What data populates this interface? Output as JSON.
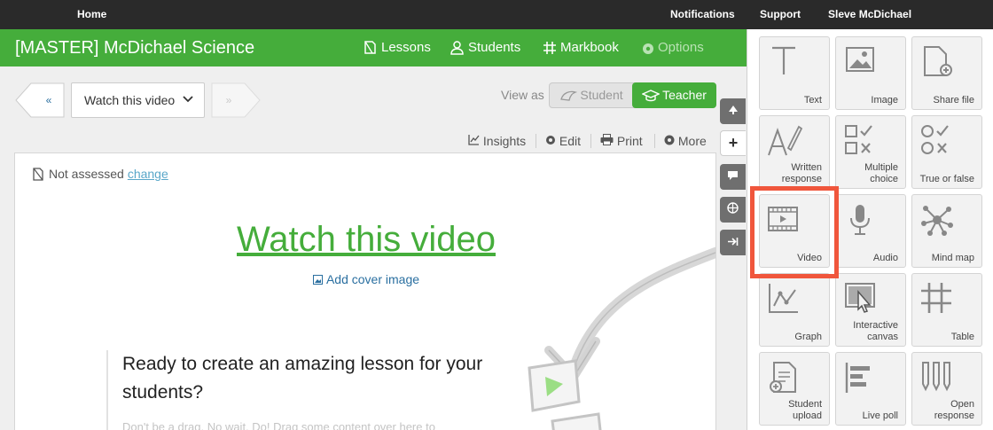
{
  "topbar": {
    "home": "Home",
    "notifications": "Notifications",
    "support": "Support",
    "user": "Sleve McDichael"
  },
  "header": {
    "course_title": "[MASTER] McDichael Science",
    "nav": {
      "lessons": "Lessons",
      "students": "Students",
      "markbook": "Markbook",
      "options": "Options"
    }
  },
  "lesson_nav": {
    "prev": "«",
    "selected": "Watch this video",
    "next": "»"
  },
  "view_as": {
    "label": "View as",
    "student": "Student",
    "teacher": "Teacher",
    "active": "Teacher"
  },
  "actions": {
    "insights": "Insights",
    "edit": "Edit",
    "print": "Print",
    "more": "More"
  },
  "card": {
    "assessment_status": "Not assessed",
    "change_link": "change",
    "title": "Watch this video",
    "add_cover": "Add cover image",
    "prompt": "Ready to create an amazing lesson for your students?",
    "prompt_sub": "Don't be a drag. No wait. Do! Drag some content over here to"
  },
  "side_tools": [
    "tree-icon",
    "plus-icon",
    "comment-icon",
    "globe-icon",
    "collapse-icon"
  ],
  "colors": {
    "brand_green": "#45ad3b",
    "topbar": "#2a2a2a",
    "highlight": "#f0563c"
  },
  "content_types": [
    {
      "label": "Text",
      "icon": "text-icon"
    },
    {
      "label": "Image",
      "icon": "image-icon"
    },
    {
      "label": "Share file",
      "icon": "share-file-icon"
    },
    {
      "label": "Written response",
      "icon": "written-response-icon"
    },
    {
      "label": "Multiple choice",
      "icon": "multiple-choice-icon"
    },
    {
      "label": "True or false",
      "icon": "true-false-icon"
    },
    {
      "label": "Video",
      "icon": "video-icon"
    },
    {
      "label": "Audio",
      "icon": "microphone-icon"
    },
    {
      "label": "Mind map",
      "icon": "mind-map-icon"
    },
    {
      "label": "Graph",
      "icon": "graph-icon"
    },
    {
      "label": "Interactive canvas",
      "icon": "interactive-canvas-icon"
    },
    {
      "label": "Table",
      "icon": "table-icon"
    },
    {
      "label": "Student upload",
      "icon": "student-upload-icon"
    },
    {
      "label": "Live poll",
      "icon": "live-poll-icon"
    },
    {
      "label": "Open response",
      "icon": "open-response-icon"
    }
  ]
}
